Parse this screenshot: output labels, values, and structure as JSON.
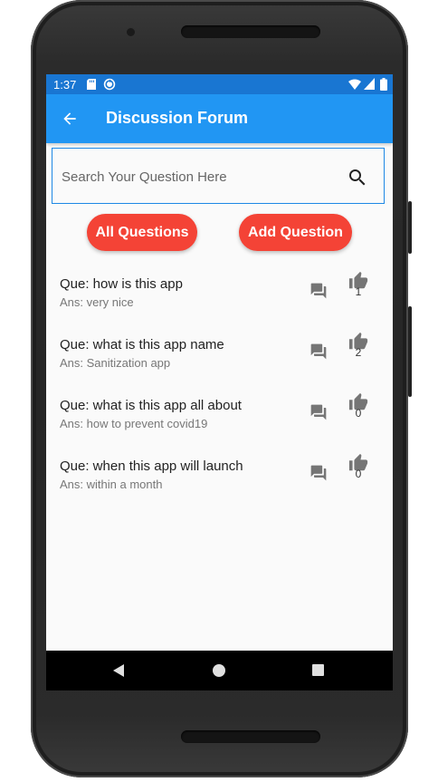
{
  "status_bar": {
    "time": "1:37",
    "icons": [
      "sd-card-icon",
      "sync-icon",
      "wifi-icon",
      "signal-icon",
      "battery-icon"
    ]
  },
  "app_bar": {
    "title": "Discussion Forum",
    "back_icon": "arrow-back-icon"
  },
  "search": {
    "placeholder": "Search Your Question Here",
    "value": "",
    "icon": "search-icon"
  },
  "buttons": {
    "all_questions": "All Questions",
    "add_question": "Add Question"
  },
  "questions": [
    {
      "question": "Que: how is this app",
      "answer": "Ans: very nice",
      "likes": "1"
    },
    {
      "question": "Que: what is this app name",
      "answer": "Ans: Sanitization app",
      "likes": "2"
    },
    {
      "question": "Que: what is this app all about",
      "answer": "Ans: how to prevent covid19",
      "likes": "0"
    },
    {
      "question": "Que: when this app will launch",
      "answer": "Ans: within a month",
      "likes": "0"
    }
  ],
  "colors": {
    "app_bar": "#2196f3",
    "status_bar": "#1976d2",
    "pill_button": "#f44336",
    "icon_grey": "#757575"
  },
  "nav_bar": {
    "icons": [
      "nav-back-icon",
      "nav-home-icon",
      "nav-recents-icon"
    ]
  }
}
